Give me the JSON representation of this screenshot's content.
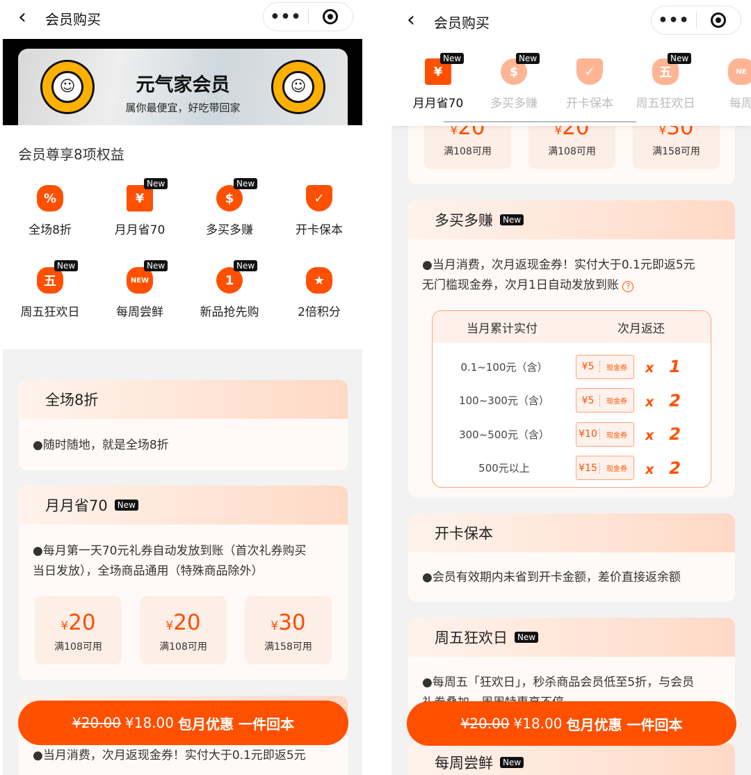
{
  "left": {
    "nav": {
      "title": "会员购买",
      "more": "•••"
    },
    "banner": {
      "title": "元气家会员",
      "subtitle": "属你最便宜，好吃带回家"
    },
    "benefits_title": "会员尊享8项权益",
    "benefits": [
      {
        "label": "全场8折",
        "icon": "percent-badge-icon",
        "glyph": "%",
        "new": false
      },
      {
        "label": "月月省70",
        "icon": "yen-ticket-icon",
        "glyph": "¥",
        "new": true
      },
      {
        "label": "多买多赚",
        "icon": "dollar-coin-icon",
        "glyph": "$",
        "new": true
      },
      {
        "label": "开卡保本",
        "icon": "shield-check-icon",
        "glyph": "✓",
        "new": false
      },
      {
        "label": "周五狂欢日",
        "icon": "friday-badge-icon",
        "glyph": "五",
        "new": true
      },
      {
        "label": "每周尝鲜",
        "icon": "new-badge-icon",
        "glyph": "NEW",
        "new": true
      },
      {
        "label": "新品抢先购",
        "icon": "number-one-icon",
        "glyph": "1",
        "new": true
      },
      {
        "label": "2倍积分",
        "icon": "star-badge-icon",
        "glyph": "★",
        "new": false
      }
    ],
    "new_tag": "New",
    "card1": {
      "title": "全场8折",
      "text": "●随时随地，就是全场8折"
    },
    "card2": {
      "title": "月月省70",
      "text1": "●每月第一天70元礼券自动发放到账（首次礼券购买",
      "text2": "当日发放），全场商品通用（特殊商品除外）",
      "coupons": [
        {
          "currency": "¥",
          "amount": "20",
          "cond": "满108可用"
        },
        {
          "currency": "¥",
          "amount": "20",
          "cond": "满108可用"
        },
        {
          "currency": "¥",
          "amount": "30",
          "cond": "满158可用"
        }
      ]
    },
    "card3": {
      "text": "●当月消费，次月返现金券！实付大于0.1元即返5元"
    }
  },
  "cta": {
    "old_price": "¥20.00",
    "price": "¥18.00",
    "label": "包月优惠 一件回本"
  },
  "right": {
    "nav": {
      "title": "会员购买",
      "more": "•••"
    },
    "tabs": [
      {
        "label": "月月省70",
        "active": true,
        "new": true,
        "glyph": "¥"
      },
      {
        "label": "多买多赚",
        "new": true,
        "glyph": "$"
      },
      {
        "label": "开卡保本",
        "new": false,
        "glyph": "✓"
      },
      {
        "label": "周五狂欢日",
        "new": true,
        "glyph": "五"
      },
      {
        "label": "每周",
        "new": false,
        "glyph": "NE"
      }
    ],
    "coupons": [
      {
        "currency": "¥",
        "amount": "20",
        "cond": "满108可用"
      },
      {
        "currency": "¥",
        "amount": "20",
        "cond": "满108可用"
      },
      {
        "currency": "¥",
        "amount": "30",
        "cond": "满158可用"
      }
    ],
    "duomai": {
      "title": "多买多赚",
      "text1": "●当月消费，次月返现金券！实付大于0.1元即返5元",
      "text2": "无门槛现金券，次月1日自动发放到账",
      "table": {
        "headers": [
          "当月累计实付",
          "次月返还"
        ],
        "voucher_label": "现金券",
        "times": "x",
        "rows": [
          {
            "range": "0.1~100元（含）",
            "amount": "¥5",
            "count": "1"
          },
          {
            "range": "100~300元（含）",
            "amount": "¥5",
            "count": "2"
          },
          {
            "range": "300~500元（含）",
            "amount": "¥10",
            "count": "2"
          },
          {
            "range": "500元以上",
            "amount": "¥15",
            "count": "2"
          }
        ]
      }
    },
    "kaika": {
      "title": "开卡保本",
      "text": "●会员有效期内未省到开卡金额，差价直接返余额"
    },
    "friday": {
      "title": "周五狂欢日",
      "text1": "●每周五「狂欢日」，秒杀商品会员低至5折，与会员",
      "text2": "礼券叠加，周周特惠享不停"
    },
    "weekly": {
      "title": "每周尝鲜"
    }
  },
  "colors": {
    "brand": "#ff5000",
    "tab_inactive_icon": "#ffb494"
  }
}
